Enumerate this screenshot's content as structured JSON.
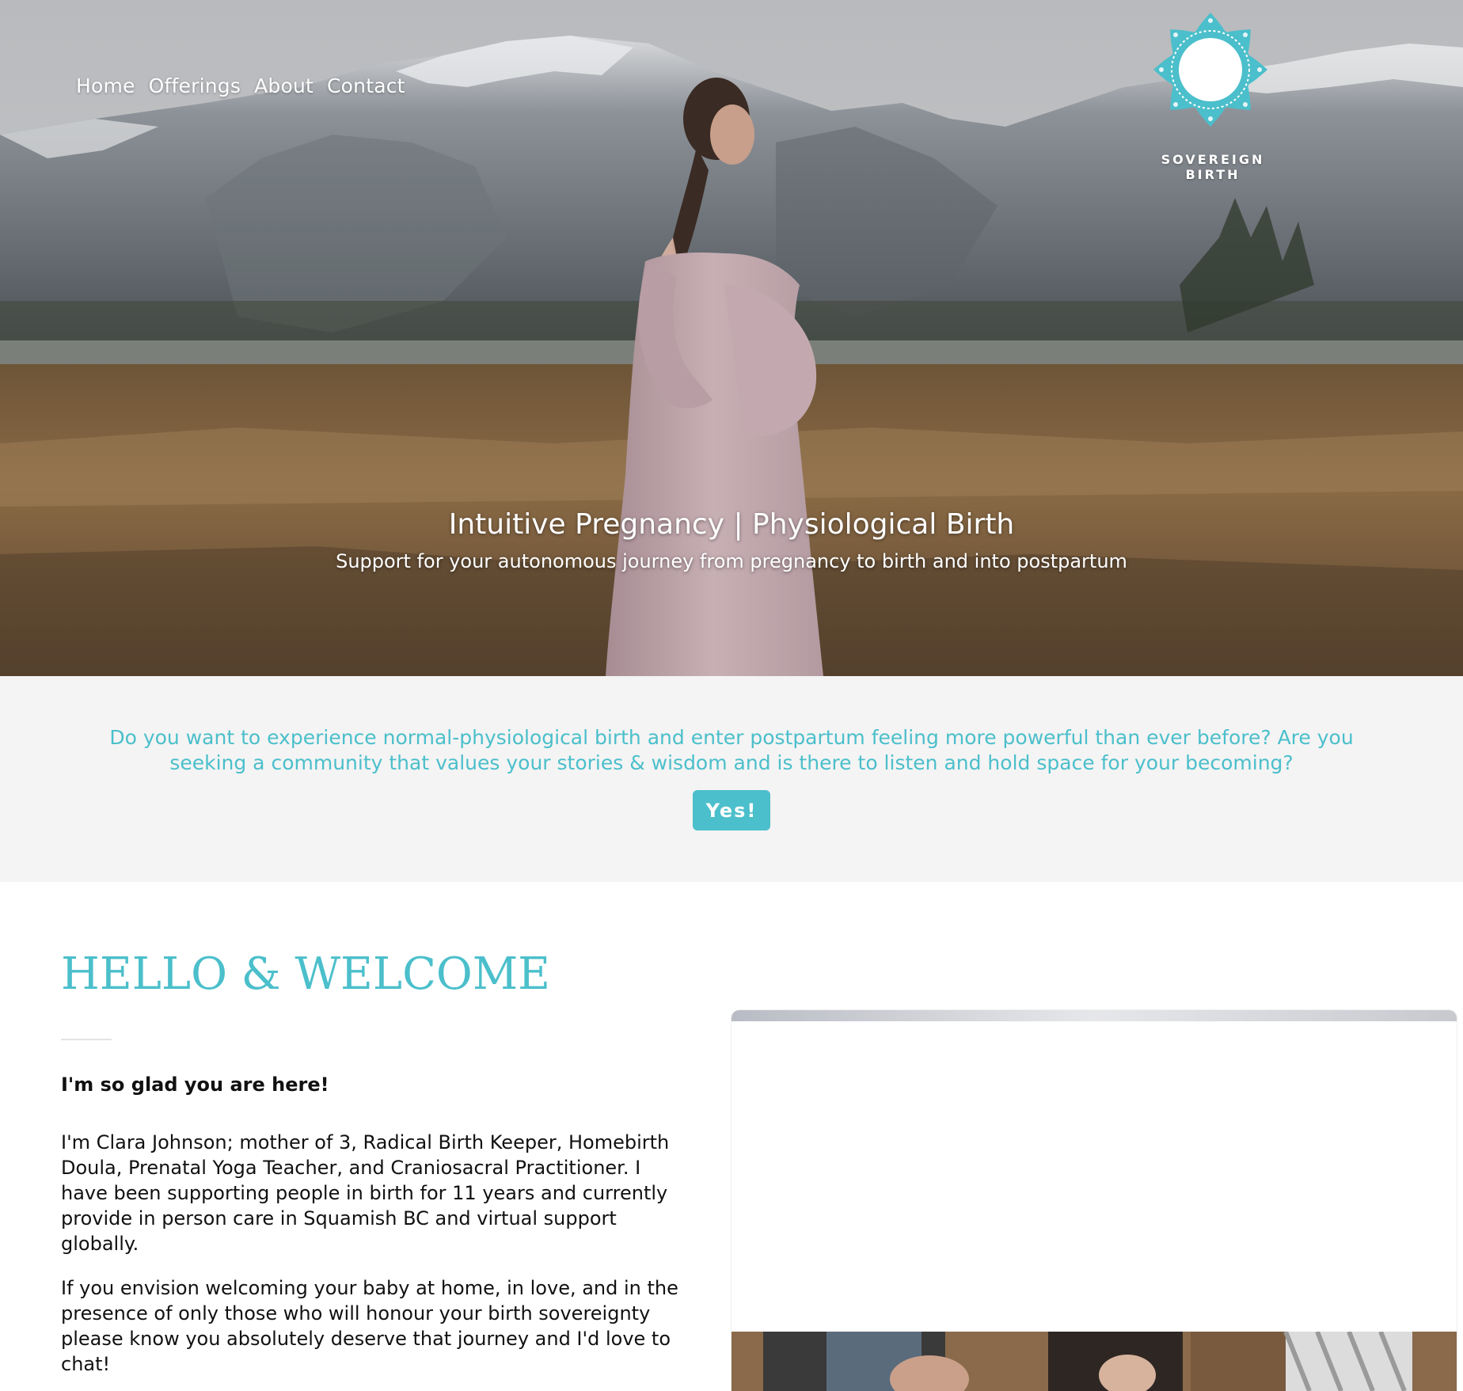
{
  "nav": {
    "items": [
      "Home",
      "Offerings",
      "About",
      "Contact"
    ]
  },
  "logo": {
    "brand": "SOVEREIGN BIRTH",
    "icon": "mandala-flower-icon",
    "color": "#4bbfcb"
  },
  "hero": {
    "title": "Intuitive Pregnancy | Physiological Birth",
    "subtitle": "Support for your autonomous journey from pregnancy to birth and into postpartum"
  },
  "cta": {
    "question": "Do you want to experience normal-physiological birth and enter postpartum feeling more powerful than ever before? Are you seeking a community that values your stories & wisdom and is there to listen and hold space for your becoming?",
    "button_label": "Yes!"
  },
  "welcome": {
    "title": "HELLO & WELCOME",
    "greeting": "I'm so glad you are here!",
    "paragraph1": "I'm Clara Johnson; mother of 3, Radical Birth Keeper, Homebirth Doula, Prenatal Yoga Teacher, and Craniosacral Practitioner. I have been supporting people in birth for 11 years and currently provide in person care in Squamish BC and virtual support globally.",
    "paragraph2": "If you envision welcoming your baby at home, in love, and in the presence of only those who will honour your birth sovereignty please know you absolutely deserve that journey and I'd love to chat!"
  },
  "colors": {
    "accent": "#4bbfcb",
    "band_background": "#f4f4f4",
    "text": "#111111"
  }
}
